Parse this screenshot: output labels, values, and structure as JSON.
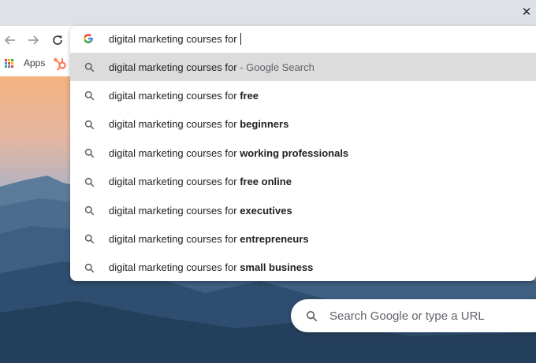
{
  "window": {
    "close_glyph": "✕"
  },
  "toolbar": {
    "back_icon": "arrow-left-icon",
    "forward_icon": "arrow-right-icon",
    "reload_icon": "reload-icon"
  },
  "bookmarks": {
    "apps_label": "Apps",
    "apps_colors": [
      "#ea4335",
      "#fbbc05",
      "#34a853",
      "#4285f4",
      "#ea4335",
      "#fbbc05",
      "#34a853",
      "#4285f4",
      "#ea4335"
    ],
    "hubspot_color": "#ff7a59"
  },
  "omnibox": {
    "query": "digital marketing courses for ",
    "suggestions": [
      {
        "prefix": "digital marketing courses for",
        "bold": "",
        "suffix": " - Google Search",
        "selected": true
      },
      {
        "prefix": "digital marketing courses for ",
        "bold": "free",
        "suffix": "",
        "selected": false
      },
      {
        "prefix": "digital marketing courses for ",
        "bold": "beginners",
        "suffix": "",
        "selected": false
      },
      {
        "prefix": "digital marketing courses for ",
        "bold": "working professionals",
        "suffix": "",
        "selected": false
      },
      {
        "prefix": "digital marketing courses for ",
        "bold": "free online",
        "suffix": "",
        "selected": false
      },
      {
        "prefix": "digital marketing courses for ",
        "bold": "executives",
        "suffix": "",
        "selected": false
      },
      {
        "prefix": "digital marketing courses for ",
        "bold": "entrepreneurs",
        "suffix": "",
        "selected": false
      },
      {
        "prefix": "digital marketing courses for ",
        "bold": "small business",
        "suffix": "",
        "selected": false
      }
    ]
  },
  "ntp": {
    "search_placeholder": "Search Google or type a URL"
  }
}
